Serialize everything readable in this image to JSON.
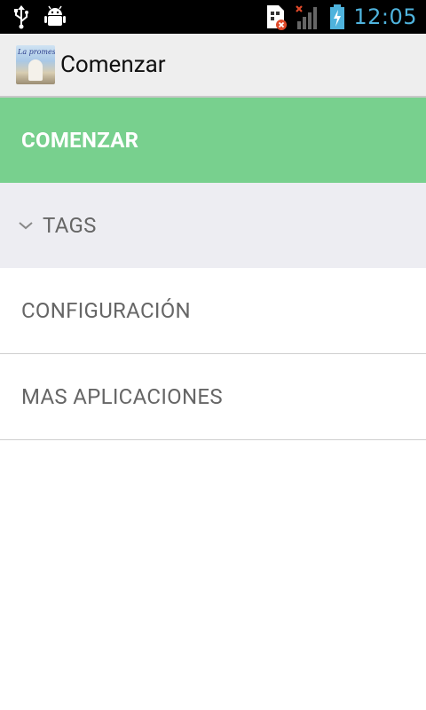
{
  "status_bar": {
    "time": "12:05",
    "icons": [
      "usb-icon",
      "android-debug-icon",
      "sim-card-error-icon",
      "signal-no-service-icon",
      "battery-charging-icon"
    ]
  },
  "action_bar": {
    "title": "Comenzar",
    "logo_text": "La promesa"
  },
  "menu": {
    "items": [
      {
        "label": "COMENZAR",
        "state": "selected"
      },
      {
        "label": "TAGS",
        "state": "collapsed-group"
      },
      {
        "label": "CONFIGURACIÓN"
      },
      {
        "label": "MAS APLICACIONES"
      }
    ]
  },
  "colors": {
    "status_bar_bg": "#000000",
    "status_accent": "#4fb3dd",
    "action_bar_bg": "#eeeeee",
    "selected_item_bg": "#78d08e",
    "group_item_bg": "#ededf2",
    "item_text": "#666666"
  }
}
